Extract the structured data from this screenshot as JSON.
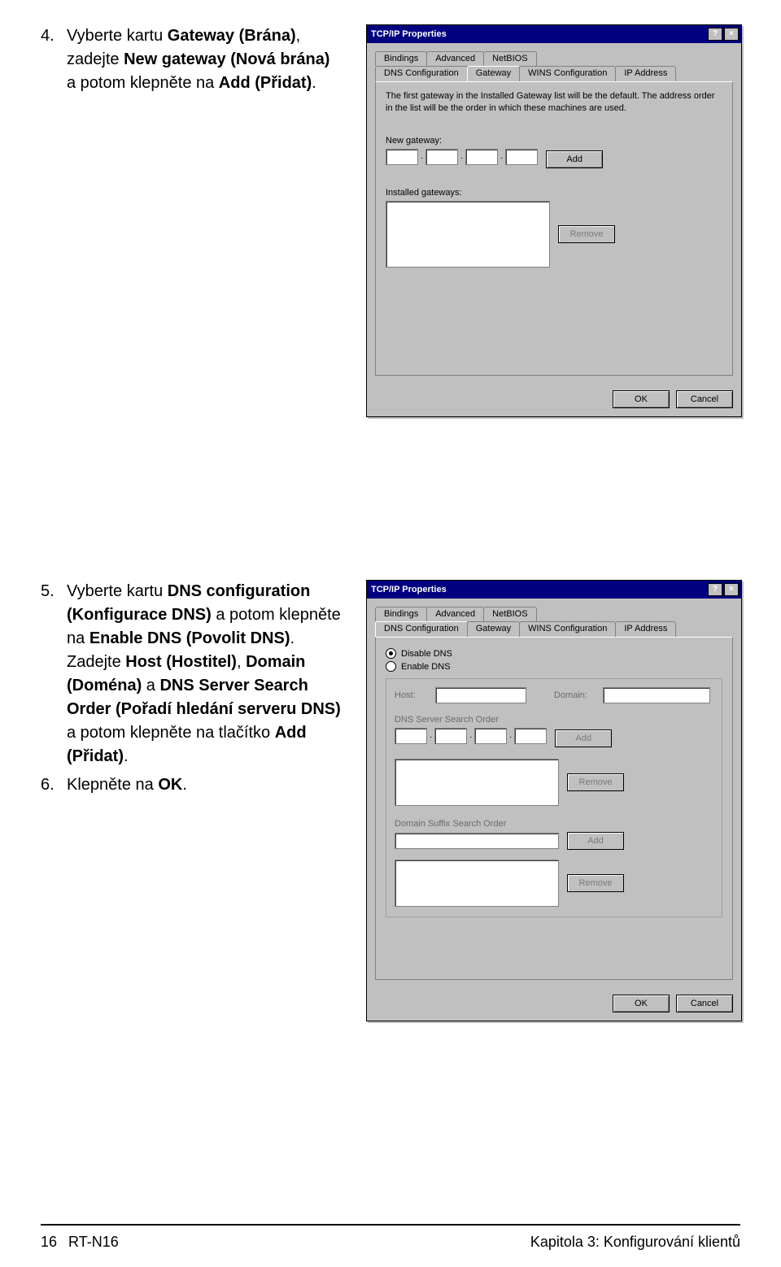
{
  "step4": {
    "num": "4.",
    "t1": "Vyberte kartu ",
    "b1": "Gateway (Brána)",
    "t2": ", zadejte ",
    "b2": "New gateway (Nová brána)",
    "t3": " a potom klepněte na ",
    "b3": "Add (Přidat)",
    "t4": "."
  },
  "step5": {
    "num": "5.",
    "t1": "Vyberte kartu ",
    "b1": "DNS configuration (Konfigurace DNS)",
    "t2": " a potom klepněte na ",
    "b2": "Enable DNS (Povolit DNS)",
    "t3": ". Zadejte ",
    "b3": "Host (Hostitel)",
    "t4": ", ",
    "b4": "Domain (Doména)",
    "t5": " a ",
    "b5": "DNS Server Search Order (Pořadí hledání serveru DNS)",
    "t6": " a potom klepněte na tlačítko ",
    "b6": "Add (Přidat)",
    "t7": "."
  },
  "step6": {
    "num": "6.",
    "t1": "Klepněte na ",
    "b1": "OK",
    "t2": "."
  },
  "dialog1": {
    "title": "TCP/IP Properties",
    "help": "?",
    "close": "×",
    "tabsTop": [
      "Bindings",
      "Advanced",
      "NetBIOS"
    ],
    "tabsBottom": [
      "DNS Configuration",
      "Gateway",
      "WINS Configuration",
      "IP Address"
    ],
    "activeTab": "Gateway",
    "desc": "The first gateway in the Installed Gateway list will be the default. The address order in the list will be the order in which these machines are used.",
    "newGatewayLabel": "New gateway:",
    "addBtn": "Add",
    "installedLabel": "Installed gateways:",
    "removeBtn": "Remove",
    "ok": "OK",
    "cancel": "Cancel"
  },
  "dialog2": {
    "title": "TCP/IP Properties",
    "help": "?",
    "close": "×",
    "tabsTop": [
      "Bindings",
      "Advanced",
      "NetBIOS"
    ],
    "tabsBottom": [
      "DNS Configuration",
      "Gateway",
      "WINS Configuration",
      "IP Address"
    ],
    "activeTab": "DNS Configuration",
    "disableDns": "Disable DNS",
    "enableDns": "Enable DNS",
    "hostLabel": "Host:",
    "domainLabel": "Domain:",
    "dnsSearchLabel": "DNS Server Search Order",
    "addBtn": "Add",
    "removeBtn": "Remove",
    "domainSuffixLabel": "Domain Suffix Search Order",
    "addBtn2": "Add",
    "removeBtn2": "Remove",
    "ok": "OK",
    "cancel": "Cancel"
  },
  "footer": {
    "pageNum": "16",
    "model": "RT-N16",
    "chapter": "Kapitola 3: Konfigurování klientů"
  }
}
